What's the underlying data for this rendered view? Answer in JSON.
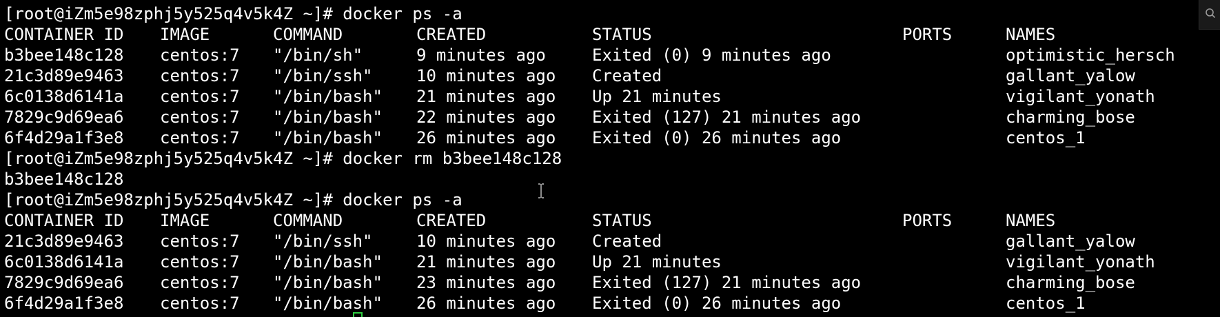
{
  "prompt": "[root@iZm5e98zphj5y525q4v5k4Z ~]# ",
  "columns": [
    "CONTAINER ID",
    "IMAGE",
    "COMMAND",
    "CREATED",
    "STATUS",
    "PORTS",
    "NAMES"
  ],
  "session": [
    {
      "command": "docker ps -a",
      "rows": [
        [
          "b3bee148c128",
          "centos:7",
          "\"/bin/sh\"",
          "9 minutes ago",
          "Exited (0) 9 minutes ago",
          "",
          "optimistic_herschel"
        ],
        [
          "21c3d89e9463",
          "centos:7",
          "\"/bin/ssh\"",
          "10 minutes ago",
          "Created",
          "",
          "gallant_yalow"
        ],
        [
          "6c0138d6141a",
          "centos:7",
          "\"/bin/bash\"",
          "21 minutes ago",
          "Up 21 minutes",
          "",
          "vigilant_yonath"
        ],
        [
          "7829c9d69ea6",
          "centos:7",
          "\"/bin/bash\"",
          "22 minutes ago",
          "Exited (127) 21 minutes ago",
          "",
          "charming_bose"
        ],
        [
          "6f4d29a1f3e8",
          "centos:7",
          "\"/bin/bash\"",
          "26 minutes ago",
          "Exited (0) 26 minutes ago",
          "",
          "centos_1"
        ]
      ]
    },
    {
      "command": "docker rm b3bee148c128",
      "output": "b3bee148c128"
    },
    {
      "command": "docker ps -a",
      "rows": [
        [
          "21c3d89e9463",
          "centos:7",
          "\"/bin/ssh\"",
          "10 minutes ago",
          "Created",
          "",
          "gallant_yalow"
        ],
        [
          "6c0138d6141a",
          "centos:7",
          "\"/bin/bash\"",
          "21 minutes ago",
          "Up 21 minutes",
          "",
          "vigilant_yonath"
        ],
        [
          "7829c9d69ea6",
          "centos:7",
          "\"/bin/bash\"",
          "23 minutes ago",
          "Exited (127) 21 minutes ago",
          "",
          "charming_bose"
        ],
        [
          "6f4d29a1f3e8",
          "centos:7",
          "\"/bin/bash\"",
          "26 minutes ago",
          "Exited (0) 26 minutes ago",
          "",
          "centos_1"
        ]
      ]
    }
  ],
  "icons": {
    "side_button": "search-icon",
    "mouse_cursor": "text-cursor-icon",
    "prompt_cursor": "terminal-cursor-icon"
  },
  "colors": {
    "background": "#000000",
    "text": "#ffffff",
    "cursor": "#2ecc40"
  }
}
